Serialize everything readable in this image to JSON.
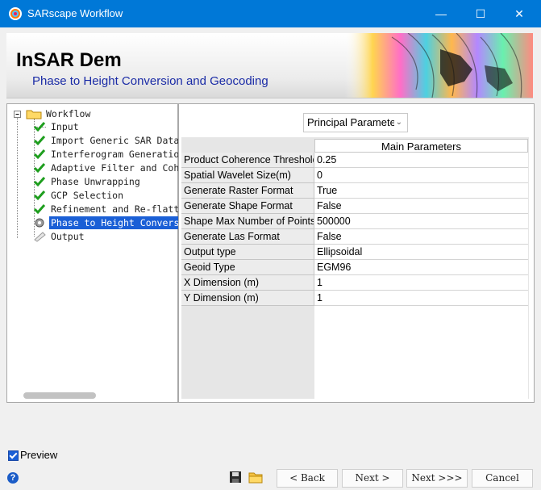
{
  "window": {
    "title": "SARscape Workflow",
    "minimize": "—",
    "maximize": "☐",
    "close": "✕"
  },
  "banner": {
    "title": "InSAR Dem",
    "subtitle": "Phase to Height Conversion and Geocoding"
  },
  "tree": {
    "root": "Workflow",
    "items": [
      {
        "label": "Input",
        "status": "done"
      },
      {
        "label": "Import Generic SAR Data",
        "status": "done"
      },
      {
        "label": "Interferogram Generation",
        "status": "done"
      },
      {
        "label": "Adaptive Filter and Coherence",
        "status": "done"
      },
      {
        "label": "Phase Unwrapping",
        "status": "done"
      },
      {
        "label": "GCP Selection",
        "status": "done"
      },
      {
        "label": "Refinement and Re-flattening",
        "status": "done"
      },
      {
        "label": "Phase to Height Conversion",
        "status": "current"
      },
      {
        "label": "Output",
        "status": "pending"
      }
    ]
  },
  "params": {
    "combo_value": "Principal Parameters",
    "header": "Main Parameters",
    "rows": [
      {
        "name": "Product Coherence Threshold",
        "value": "0.25"
      },
      {
        "name": "Spatial Wavelet Size(m)",
        "value": "0"
      },
      {
        "name": "Generate Raster Format",
        "value": "True"
      },
      {
        "name": "Generate Shape Format",
        "value": "False"
      },
      {
        "name": "Shape Max Number of Points",
        "value": "500000"
      },
      {
        "name": "Generate Las Format",
        "value": "False"
      },
      {
        "name": "Output type",
        "value": "Ellipsoidal"
      },
      {
        "name": "Geoid Type",
        "value": "EGM96"
      },
      {
        "name": "X Dimension (m)",
        "value": "1"
      },
      {
        "name": "Y Dimension (m)",
        "value": "1"
      }
    ]
  },
  "footer": {
    "preview_label": "Preview",
    "preview_checked": true,
    "help": "?",
    "save_icon": "save-icon",
    "open_icon": "folder-icon",
    "back_label": "< Back",
    "next_label": "Next >",
    "next_all_label": "Next >>>",
    "cancel_label": "Cancel"
  },
  "colors": {
    "titlebar": "#0078d7",
    "selection": "#1a5fd6",
    "check": "#1e9e1e",
    "subtitle": "#1a2ba6"
  }
}
